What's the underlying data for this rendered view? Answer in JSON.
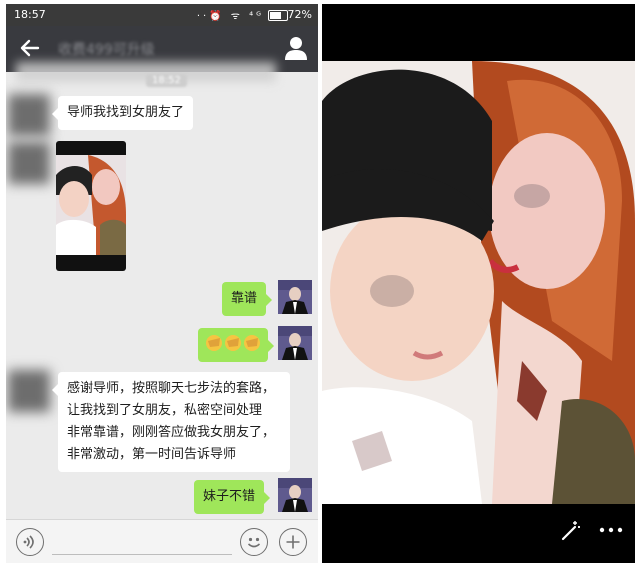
{
  "status_bar": {
    "time": "18:57",
    "icons": "··⏰ ᯤ ⁴ᴳ",
    "battery_pct": "72%",
    "battery_level": 0.72
  },
  "chat_header": {
    "title": "收费499可升级"
  },
  "timestamp": "18:52",
  "messages": [
    {
      "side": "in",
      "type": "text",
      "text": "导师我找到女朋友了"
    },
    {
      "side": "in",
      "type": "image",
      "image": "couple-photo"
    },
    {
      "side": "out",
      "type": "text",
      "text": "靠谱"
    },
    {
      "side": "out",
      "type": "emoji",
      "emoji": [
        "facepalm",
        "facepalm",
        "facepalm"
      ]
    },
    {
      "side": "in",
      "type": "text",
      "lines": [
        "感谢导师，按照聊天七步法的套路，",
        "让我找到了女朋友，私密空间处理",
        "非常靠谱，刚刚答应做我女朋友了，",
        "非常激动，第一时间告诉导师"
      ]
    },
    {
      "side": "out",
      "type": "text",
      "text": "妹子不错"
    }
  ],
  "input_bar": {
    "icons": [
      "voice-icon",
      "emoji-icon",
      "plus-icon"
    ]
  },
  "viewer": {
    "icons": [
      "magic-wand-icon",
      "more-icon"
    ]
  },
  "colors": {
    "nav": "#393a3f",
    "chat_bg": "#ebebeb",
    "out_bubble": "#9fe65a",
    "in_bubble": "#ffffff"
  }
}
